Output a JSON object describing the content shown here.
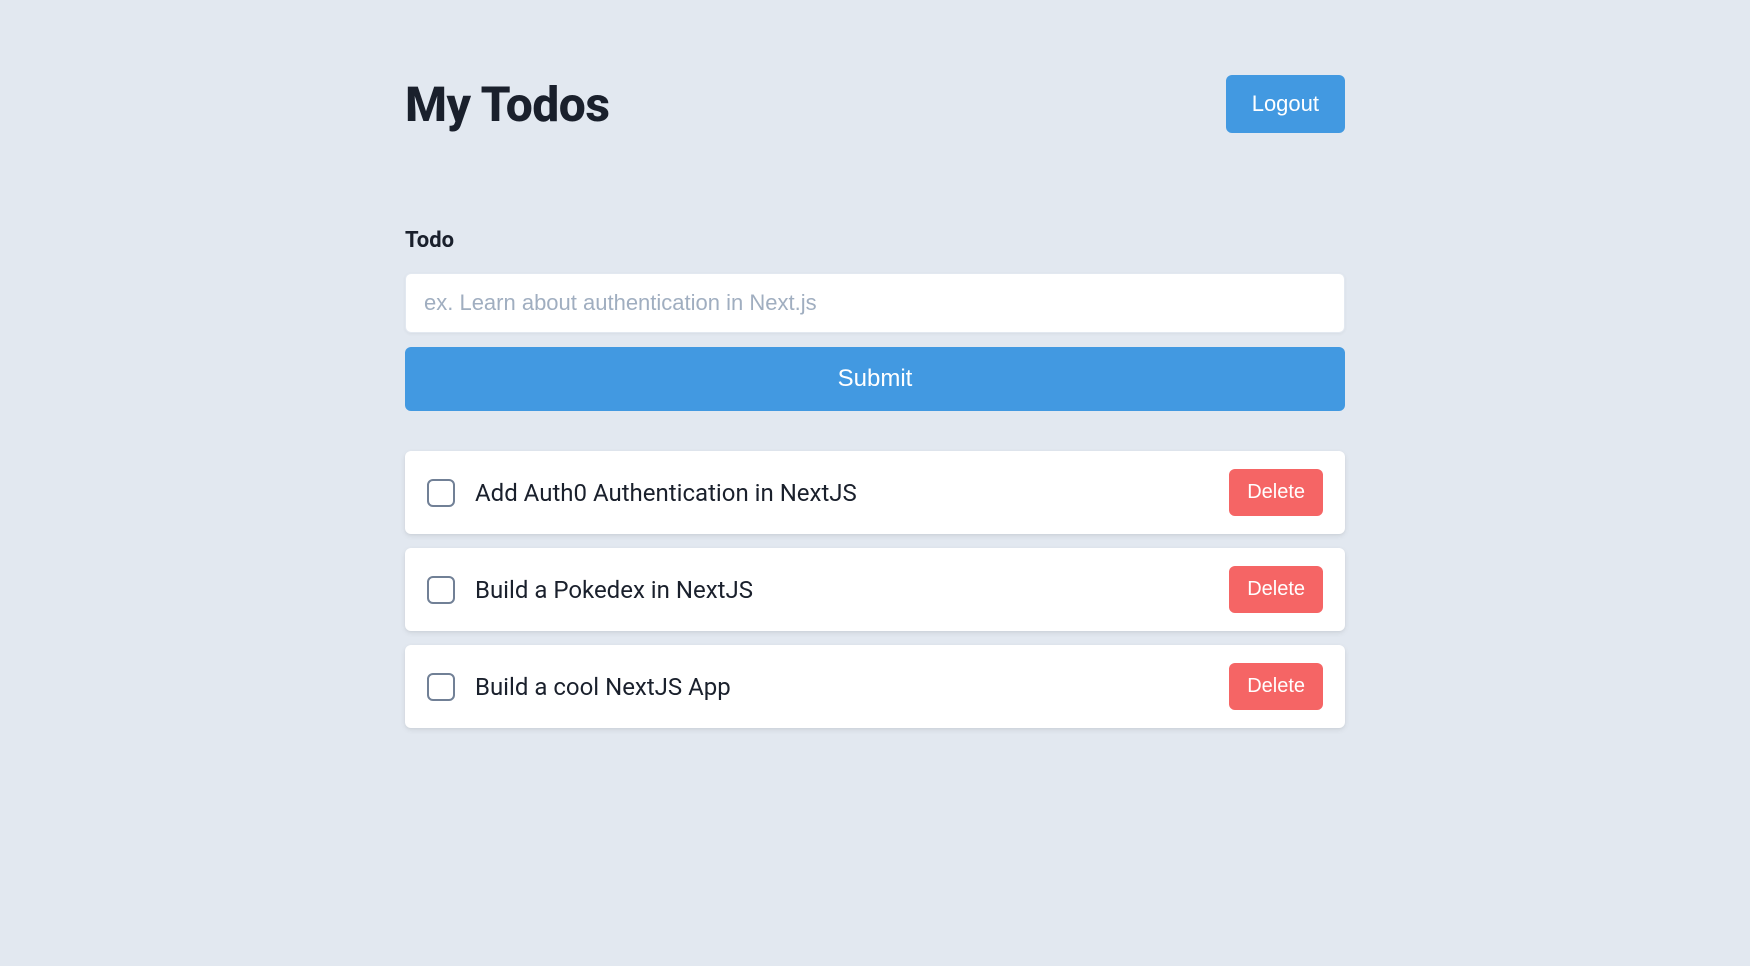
{
  "header": {
    "title": "My Todos",
    "logout_label": "Logout"
  },
  "form": {
    "label": "Todo",
    "placeholder": "ex. Learn about authentication in Next.js",
    "submit_label": "Submit"
  },
  "todos": [
    {
      "text": "Add Auth0 Authentication in NextJS",
      "completed": false,
      "delete_label": "Delete"
    },
    {
      "text": "Build a Pokedex in NextJS",
      "completed": false,
      "delete_label": "Delete"
    },
    {
      "text": "Build a cool NextJS App",
      "completed": false,
      "delete_label": "Delete"
    }
  ]
}
